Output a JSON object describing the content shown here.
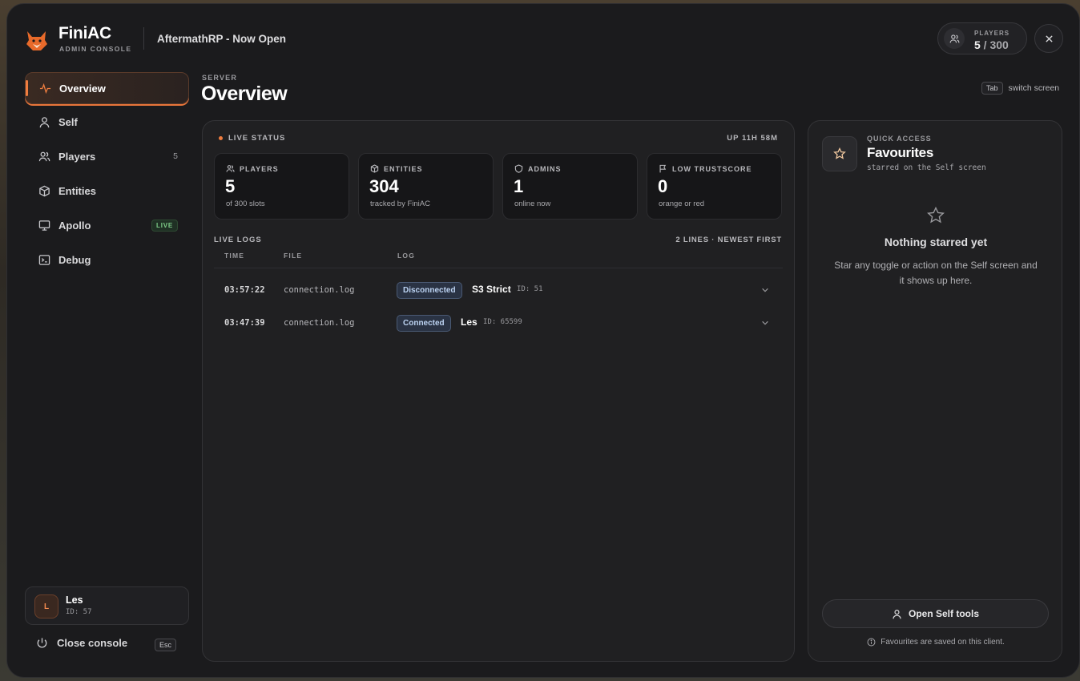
{
  "brand": {
    "name": "FiniAC",
    "subtitle": "ADMIN CONSOLE"
  },
  "header": {
    "server_name": "AftermathRP - Now Open",
    "players_label": "PLAYERS",
    "players_current": "5",
    "players_max": " / 300"
  },
  "sidebar": {
    "items": [
      {
        "label": "Overview",
        "icon": "pulse-icon",
        "active": true
      },
      {
        "label": "Self",
        "icon": "user-icon"
      },
      {
        "label": "Players",
        "icon": "users-icon",
        "count": "5"
      },
      {
        "label": "Entities",
        "icon": "cube-icon"
      },
      {
        "label": "Apollo",
        "icon": "monitor-icon",
        "badge": "LIVE"
      },
      {
        "label": "Debug",
        "icon": "terminal-icon"
      }
    ],
    "user": {
      "initial": "L",
      "name": "Les",
      "id": "ID: 57"
    },
    "close_label": "Close console",
    "close_key": "Esc"
  },
  "page": {
    "eyebrow": "SERVER",
    "title": "Overview",
    "tab_key": "Tab",
    "tab_hint": "switch screen"
  },
  "status": {
    "label": "LIVE STATUS",
    "uptime": "UP 11H 58M",
    "cards": [
      {
        "label": "PLAYERS",
        "icon": "users-icon",
        "value": "5",
        "sub": "of 300 slots"
      },
      {
        "label": "ENTITIES",
        "icon": "cube-icon",
        "value": "304",
        "sub": "tracked by FiniAC"
      },
      {
        "label": "ADMINS",
        "icon": "shield-icon",
        "value": "1",
        "sub": "online now"
      },
      {
        "label": "LOW TRUSTSCORE",
        "icon": "flag-icon",
        "value": "0",
        "sub": "orange or red"
      }
    ]
  },
  "logs": {
    "title": "LIVE LOGS",
    "meta": "2 LINES · NEWEST FIRST",
    "columns": [
      "TIME",
      "FILE",
      "LOG"
    ],
    "rows": [
      {
        "time": "03:57:22",
        "file": "connection.log",
        "badge": "Disconnected",
        "name": "S3 Strict",
        "id": "ID: 51"
      },
      {
        "time": "03:47:39",
        "file": "connection.log",
        "badge": "Connected",
        "name": "Les",
        "id": "ID: 65599"
      }
    ]
  },
  "favourites": {
    "eyebrow": "QUICK ACCESS",
    "title": "Favourites",
    "subtitle": "starred on the Self screen",
    "empty_title": "Nothing starred yet",
    "empty_desc": "Star any toggle or action on the Self screen and it shows up here.",
    "button_label": "Open Self tools",
    "footer": "Favourites are saved on this client."
  },
  "colors": {
    "accent": "#ef7d3f",
    "live_green": "#7fcf8a",
    "badge_blue": "#bcd3f2"
  }
}
